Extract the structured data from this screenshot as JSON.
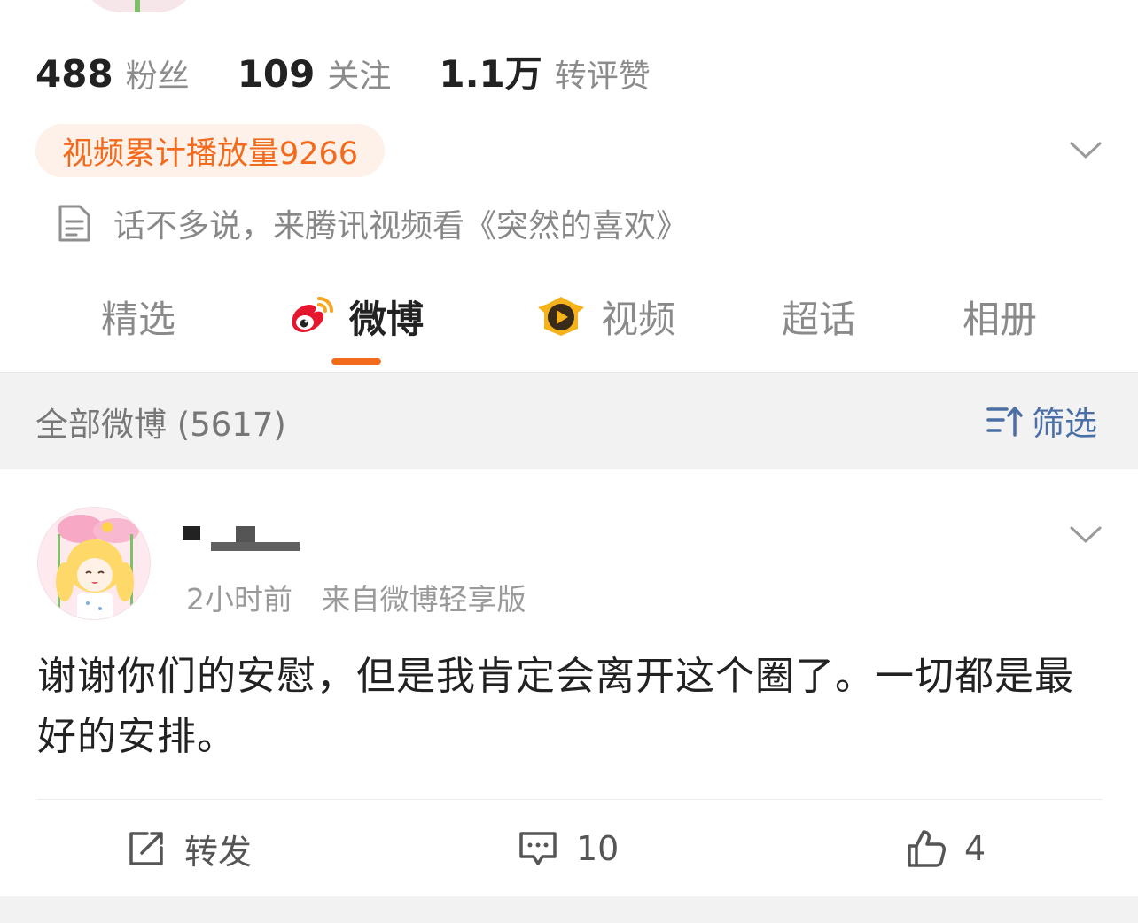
{
  "profile": {
    "stats": [
      {
        "value": "488",
        "label": "粉丝"
      },
      {
        "value": "109",
        "label": "关注"
      },
      {
        "value": "1.1万",
        "label": "转评赞"
      }
    ],
    "play_count_badge": "视频累计播放量9266",
    "bio": "话不多说，来腾讯视频看《突然的喜欢》"
  },
  "tabs": [
    {
      "label": "精选",
      "active": false
    },
    {
      "label": "微博",
      "active": true
    },
    {
      "label": "视频",
      "active": false
    },
    {
      "label": "超话",
      "active": false
    },
    {
      "label": "相册",
      "active": false
    }
  ],
  "filter_bar": {
    "title": "全部微博 (5617)",
    "filter_label": "筛选"
  },
  "post": {
    "time": "2小时前",
    "source": "来自微博轻享版",
    "text": "谢谢你们的安慰，但是我肯定会离开这个圈了。一切都是最好的安排。",
    "actions": {
      "repost_label": "转发",
      "comment_count": "10",
      "like_count": "4"
    }
  },
  "colors": {
    "accent_orange": "#f26b1d",
    "badge_bg": "#fdf1ea",
    "filter_blue": "#4a6fa5",
    "weibo_red": "#e6162d"
  },
  "icons": [
    "chevron-down-icon",
    "document-icon",
    "weibo-logo-icon",
    "video-play-icon",
    "filter-sort-icon",
    "share-edit-icon",
    "comment-icon",
    "thumbs-up-icon"
  ]
}
